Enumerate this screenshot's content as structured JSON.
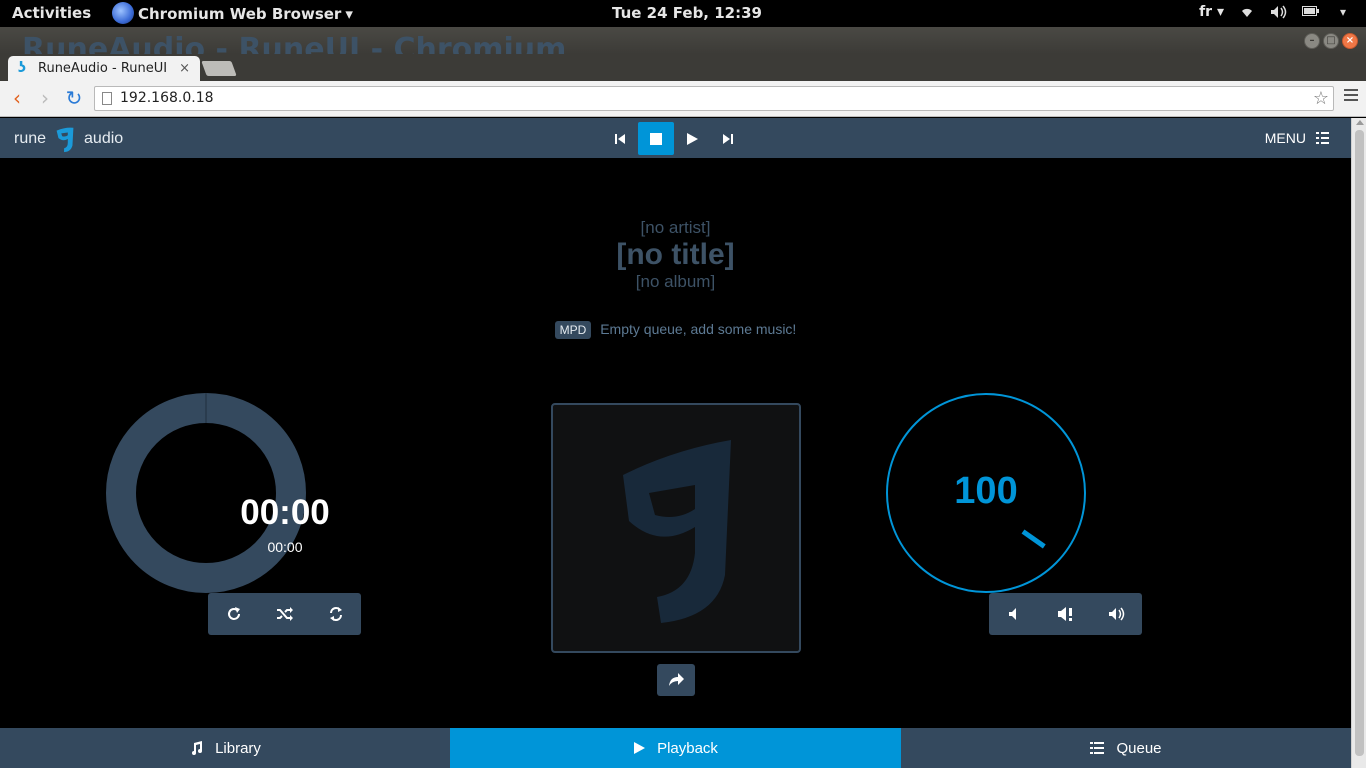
{
  "os_bar": {
    "activities": "Activities",
    "app_name": "Chromium Web Browser",
    "app_arrow": "▾",
    "clock": "Tue 24 Feb, 12:39",
    "keyboard_layout": "fr",
    "keyboard_arrow": "▾"
  },
  "window": {
    "title": "RuneAudio - RuneUI - Chromium"
  },
  "browser": {
    "tab_title": "RuneAudio - RuneUI",
    "tab_close": "×",
    "url": "192.168.0.18",
    "back": "‹",
    "forward": "›",
    "reload": "↻",
    "star": "☆"
  },
  "rune": {
    "logo_left": "rune",
    "logo_right": "audio",
    "menu_label": "MENU",
    "artist": "[no artist]",
    "title": "[no title]",
    "album": "[no album]",
    "badge": "MPD",
    "status": "Empty queue, add some music!",
    "elapsed": "00:00",
    "total": "00:00",
    "volume": "100",
    "nav": {
      "library": "Library",
      "playback": "Playback",
      "queue": "Queue"
    }
  },
  "colors": {
    "accent": "#0095d8",
    "panel": "#34495e"
  }
}
